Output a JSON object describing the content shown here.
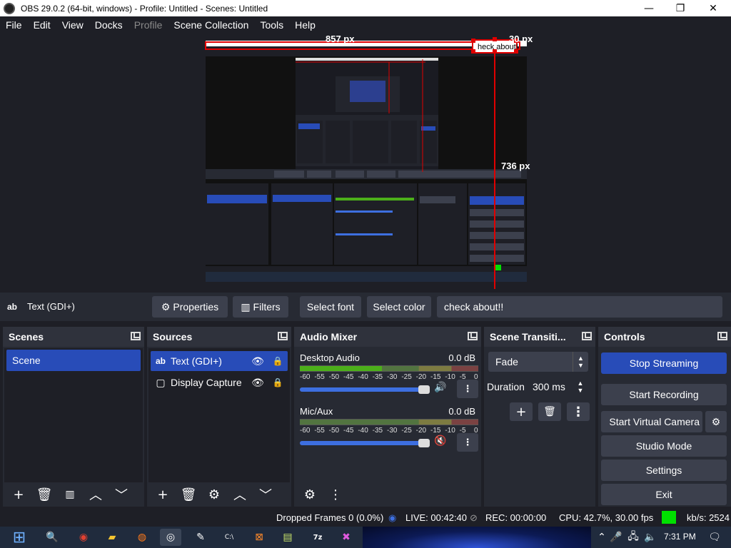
{
  "window": {
    "title": "OBS 29.0.2 (64-bit, windows) - Profile: Untitled - Scenes: Untitled",
    "minimize_glyph": "—",
    "maximize_glyph": "❐",
    "close_glyph": "✕"
  },
  "menu": [
    "File",
    "Edit",
    "View",
    "Docks",
    "Profile",
    "Scene Collection",
    "Tools",
    "Help"
  ],
  "menu_disabled": [
    "Profile"
  ],
  "preview": {
    "measure_width": "857 px",
    "measure_right": "30 px",
    "measure_bottom": "736 px",
    "overlay_text": "heck about!"
  },
  "context_bar": {
    "source_icon": "ab",
    "source_name": "Text (GDI+)",
    "properties_label": "Properties",
    "filters_label": "Filters",
    "select_font_label": "Select font",
    "select_color_label": "Select color",
    "text_value": "check about!!"
  },
  "scenes": {
    "title": "Scenes",
    "items": [
      "Scene"
    ]
  },
  "sources": {
    "title": "Sources",
    "items": [
      {
        "icon": "ab",
        "label": "Text (GDI+)",
        "selected": true
      },
      {
        "icon": "▢",
        "label": "Display Capture",
        "selected": false
      }
    ]
  },
  "audio_mixer": {
    "title": "Audio Mixer",
    "ticks": [
      "-60",
      "-55",
      "-50",
      "-45",
      "-40",
      "-35",
      "-30",
      "-25",
      "-20",
      "-15",
      "-10",
      "-5",
      "0"
    ],
    "channels": [
      {
        "name": "Desktop Audio",
        "db": "0.0 dB",
        "volume": 1.0,
        "muted": false,
        "level": 0.46
      },
      {
        "name": "Mic/Aux",
        "db": "0.0 dB",
        "volume": 1.0,
        "muted": true,
        "level": 0.0
      }
    ]
  },
  "transitions": {
    "title": "Scene Transiti...",
    "selected": "Fade",
    "duration_label": "Duration",
    "duration_value": "300 ms"
  },
  "controls": {
    "title": "Controls",
    "stop_streaming": "Stop Streaming",
    "start_recording": "Start Recording",
    "start_virtual_camera": "Start Virtual Camera",
    "studio_mode": "Studio Mode",
    "settings": "Settings",
    "exit": "Exit"
  },
  "status": {
    "dropped_frames": "Dropped Frames 0 (0.0%)",
    "live": "LIVE: 00:42:40",
    "rec": "REC: 00:00:00",
    "cpu": "CPU: 42.7%, 30.00 fps",
    "kbs": "kb/s: 2524"
  },
  "taskbar": {
    "clock": "7:31 PM"
  },
  "colors": {
    "bg": "#1e1f26",
    "panel": "#272a33",
    "button": "#3c404d",
    "accent": "#284cb8",
    "meter_green": "#4caf1a",
    "meter_yellow": "#c9c21c",
    "meter_red": "#c42020",
    "measure_red": "#e00000"
  }
}
